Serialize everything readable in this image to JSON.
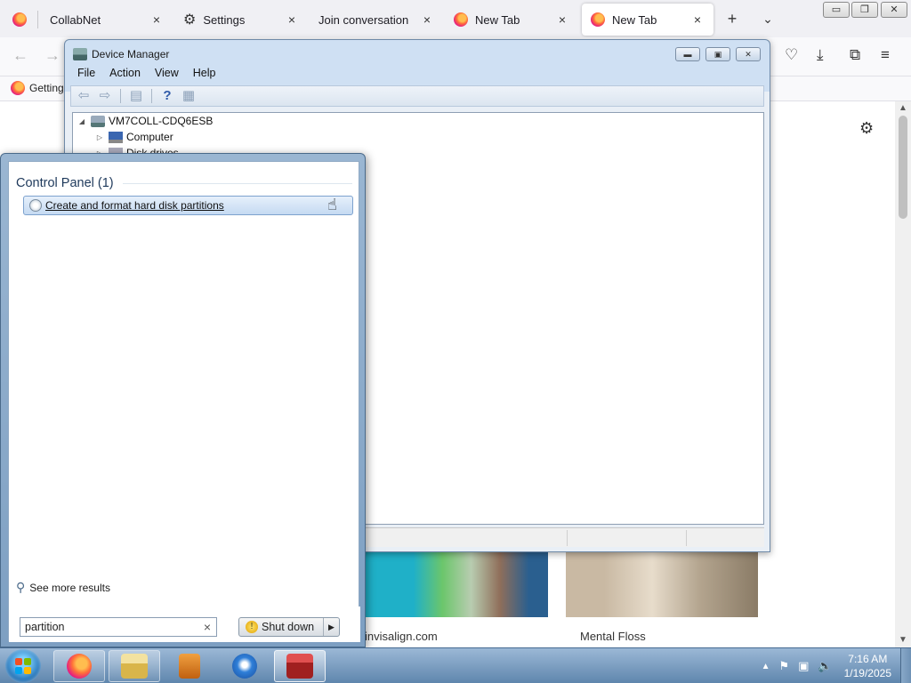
{
  "browser": {
    "tabs": [
      {
        "label": "",
        "icon": "firefox-icon"
      },
      {
        "label": "CollabNet"
      },
      {
        "label": "Settings",
        "icon": "gear-icon"
      },
      {
        "label": "Join conversation"
      },
      {
        "label": "New Tab",
        "icon": "firefox-icon"
      },
      {
        "label": "New Tab",
        "icon": "firefox-icon",
        "active": true
      }
    ],
    "new_tab": "+",
    "list_tabs": "⌄",
    "close_glyph": "×",
    "bookmark": "Getting",
    "cards": [
      {
        "title": "invisalign.com"
      },
      {
        "title": "Mental Floss"
      }
    ]
  },
  "device_manager": {
    "title": "Device Manager",
    "menus": [
      "File",
      "Action",
      "View",
      "Help"
    ],
    "tree": {
      "root": "VM7COLL-CDQ6ESB",
      "children": [
        "Computer",
        "Disk drives"
      ]
    }
  },
  "start_menu": {
    "section_header": "Control Panel (1)",
    "result": "Create and format hard disk partitions",
    "see_more": "See more results",
    "search_value": "partition",
    "shutdown": "Shut down"
  },
  "taskbar": {
    "apps": [
      "firefox",
      "file-explorer",
      "media-player",
      "thunderbird",
      "toolbox"
    ],
    "time": "7:16 AM",
    "date": "1/19/2025"
  },
  "colors": {
    "accent_blue": "#1e395b",
    "taskbar": "#5f86ad"
  }
}
